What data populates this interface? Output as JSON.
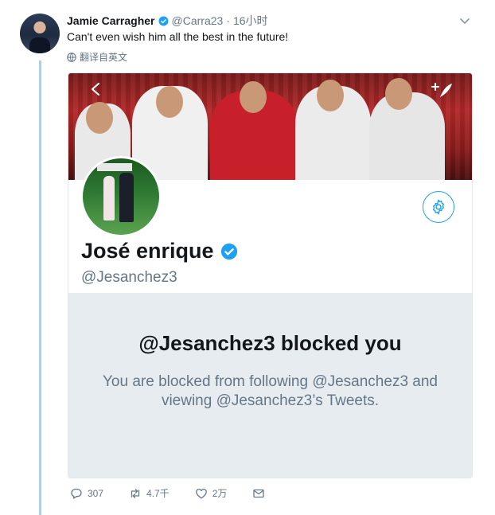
{
  "tweet": {
    "author_name": "Jamie Carragher",
    "author_handle": "@Carra23",
    "separator": "·",
    "time": "16小时",
    "text": "Can't even wish him all the best in the future!",
    "translate_label": "翻译自英文"
  },
  "embedded_profile": {
    "display_name": "José enrique",
    "handle": "@Jesanchez3",
    "blocked_title": "@Jesanchez3 blocked you",
    "blocked_message": "You are blocked from following @Jesanchez3 and viewing @Jesanchez3’s Tweets."
  },
  "actions": {
    "replies": "307",
    "retweets": "4.7千",
    "likes": "2万"
  },
  "colors": {
    "accent": "#1da1f2",
    "thread_line": "#9fd4f6",
    "muted": "#657786",
    "blocked_bg": "#e6ecf0"
  }
}
